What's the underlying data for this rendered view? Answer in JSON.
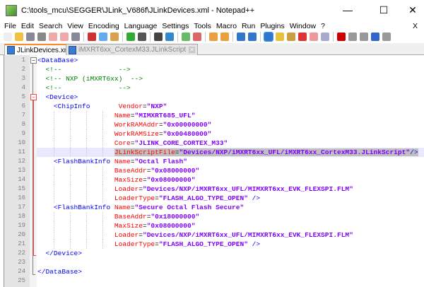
{
  "window": {
    "title": "C:\\tools_mcu\\SEGGER\\JLink_V686f\\JLinkDevices.xml - Notepad++",
    "minimize": "—",
    "maximize": "☐",
    "close": "✕"
  },
  "menu": [
    "File",
    "Edit",
    "Search",
    "View",
    "Encoding",
    "Language",
    "Settings",
    "Tools",
    "Macro",
    "Run",
    "Plugins",
    "Window",
    "?"
  ],
  "menu_close": "X",
  "toolbar_icons": [
    "new-file",
    "open-file",
    "save",
    "save-all",
    "close",
    "close-all",
    "print",
    "cut",
    "copy",
    "paste",
    "undo",
    "redo",
    "find",
    "replace",
    "zoom-in",
    "zoom-out",
    "sync-v",
    "sync-h",
    "word-wrap",
    "show-all-chars",
    "indent-guide",
    "udl",
    "doc-map",
    "function-list",
    "folder-workspace",
    "monitor",
    "record-macro",
    "stop-record",
    "play-macro",
    "run-macro-multiple",
    "save-macro"
  ],
  "tabs": [
    {
      "label": "JLinkDevices.xml",
      "active": true
    },
    {
      "label": "iMXRT6xx_CortexM33.JLinkScript",
      "active": false
    }
  ],
  "editor": {
    "current_line": 11,
    "lines": [
      [
        [
          "tag",
          "<DataBase>"
        ]
      ],
      [
        [
          "cmt",
          "  <!--              -->"
        ]
      ],
      [
        [
          "cmt",
          "  <!-- NXP (iMXRT6xx)  -->"
        ]
      ],
      [
        [
          "cmt",
          "  <!--              -->"
        ]
      ],
      [
        [
          "tag",
          "  <Device>"
        ]
      ],
      [
        [
          "tag",
          "    <ChipInfo      "
        ],
        [
          "attr",
          " Vendor"
        ],
        [
          "eq",
          "="
        ],
        [
          "val",
          "\"NXP\""
        ]
      ],
      [
        [
          "sp",
          "                   "
        ],
        [
          "attr",
          "Name"
        ],
        [
          "eq",
          "="
        ],
        [
          "val",
          "\"MIMXRT685_UFL\""
        ]
      ],
      [
        [
          "sp",
          "                   "
        ],
        [
          "attr",
          "WorkRAMAddr"
        ],
        [
          "eq",
          "="
        ],
        [
          "val",
          "\"0x00000000\""
        ]
      ],
      [
        [
          "sp",
          "                   "
        ],
        [
          "attr",
          "WorkRAMSize"
        ],
        [
          "eq",
          "="
        ],
        [
          "val",
          "\"0x00480000\""
        ]
      ],
      [
        [
          "sp",
          "                   "
        ],
        [
          "attr",
          "Core"
        ],
        [
          "eq",
          "="
        ],
        [
          "val",
          "\"JLINK_CORE_CORTEX_M33\""
        ]
      ],
      [
        [
          "sp",
          "                   "
        ],
        [
          "attr",
          "JLinkScriptFile",
          "sel"
        ],
        [
          "eq",
          "=",
          "sel"
        ],
        [
          "val",
          "\"Devices/NXP/iMXRT6xx_UFL/iMXRT6xx_CortexM33.JLinkScript\"",
          "sel"
        ],
        [
          "tag",
          "/>",
          "sel"
        ]
      ],
      [
        [
          "tag",
          "    <FlashBankInfo"
        ],
        [
          "attr",
          " Name"
        ],
        [
          "eq",
          "="
        ],
        [
          "val",
          "\"Octal Flash\""
        ]
      ],
      [
        [
          "sp",
          "                   "
        ],
        [
          "attr",
          "BaseAddr"
        ],
        [
          "eq",
          "="
        ],
        [
          "val",
          "\"0x08000000\""
        ]
      ],
      [
        [
          "sp",
          "                   "
        ],
        [
          "attr",
          "MaxSize"
        ],
        [
          "eq",
          "="
        ],
        [
          "val",
          "\"0x08000000\""
        ]
      ],
      [
        [
          "sp",
          "                   "
        ],
        [
          "attr",
          "Loader"
        ],
        [
          "eq",
          "="
        ],
        [
          "val",
          "\"Devices/NXP/iMXRT6xx_UFL/MIMXRT6xx_EVK_FLEXSPI.FLM\""
        ]
      ],
      [
        [
          "sp",
          "                   "
        ],
        [
          "attr",
          "LoaderType"
        ],
        [
          "eq",
          "="
        ],
        [
          "val",
          "\"FLASH_ALGO_TYPE_OPEN\""
        ],
        [
          "tag",
          " />"
        ]
      ],
      [
        [
          "tag",
          "    <FlashBankInfo"
        ],
        [
          "attr",
          " Name"
        ],
        [
          "eq",
          "="
        ],
        [
          "val",
          "\"Secure Octal Flash Secure\""
        ]
      ],
      [
        [
          "sp",
          "                   "
        ],
        [
          "attr",
          "BaseAddr"
        ],
        [
          "eq",
          "="
        ],
        [
          "val",
          "\"0x18000000\""
        ]
      ],
      [
        [
          "sp",
          "                   "
        ],
        [
          "attr",
          "MaxSize"
        ],
        [
          "eq",
          "="
        ],
        [
          "val",
          "\"0x08000000\""
        ]
      ],
      [
        [
          "sp",
          "                   "
        ],
        [
          "attr",
          "Loader"
        ],
        [
          "eq",
          "="
        ],
        [
          "val",
          "\"Devices/NXP/iMXRT6xx_UFL/MIMXRT6xx_EVK_FLEXSPI.FLM\""
        ]
      ],
      [
        [
          "sp",
          "                   "
        ],
        [
          "attr",
          "LoaderType"
        ],
        [
          "eq",
          "="
        ],
        [
          "val",
          "\"FLASH_ALGO_TYPE_OPEN\""
        ],
        [
          "tag",
          " />"
        ]
      ],
      [
        [
          "tag",
          "  </Device>"
        ]
      ],
      [],
      [
        [
          "tag",
          "</DataBase>"
        ]
      ],
      []
    ]
  }
}
